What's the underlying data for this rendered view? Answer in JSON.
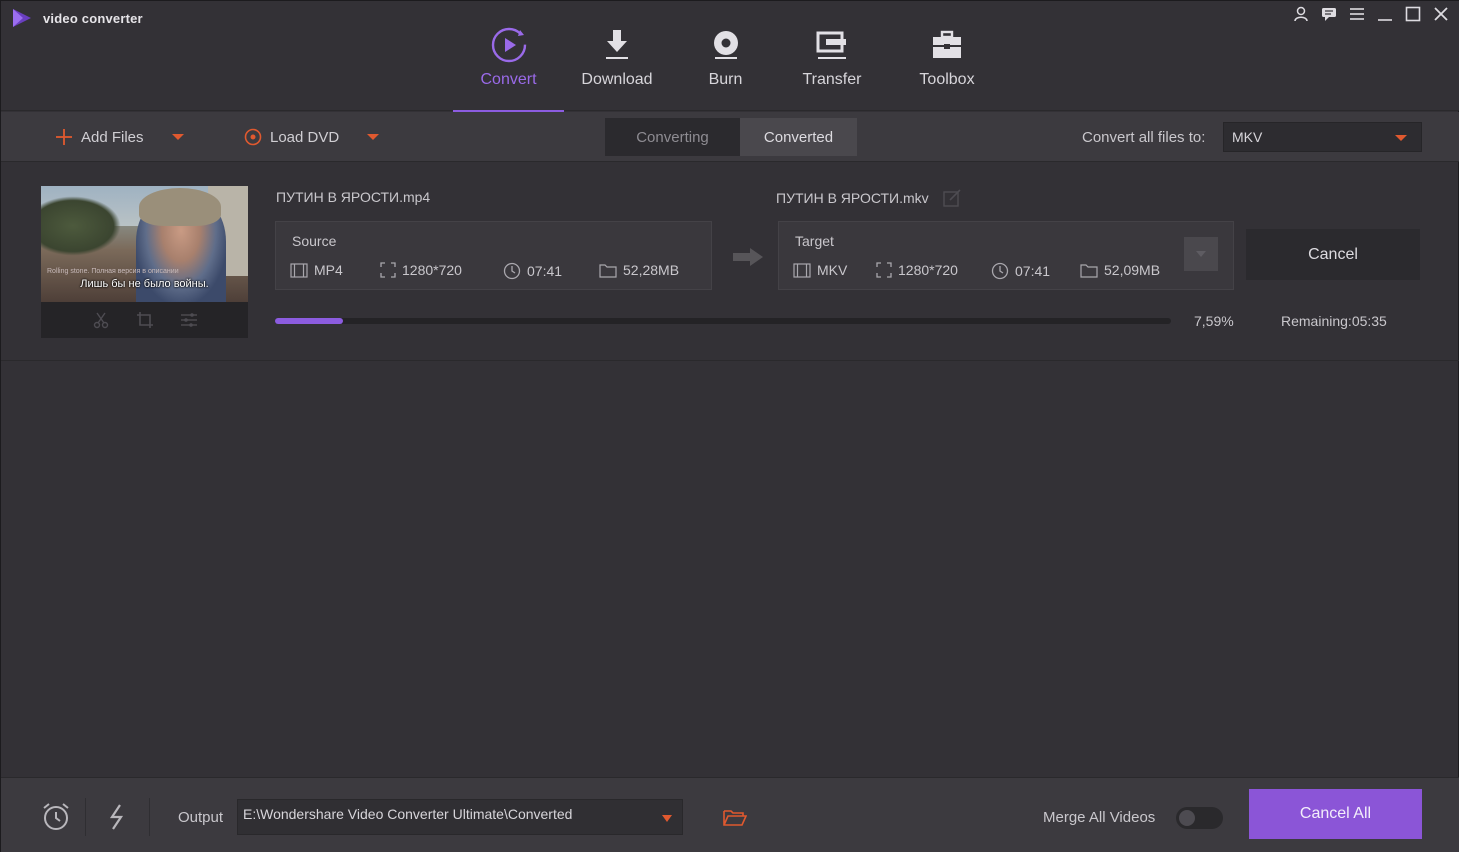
{
  "app": {
    "title": "video converter",
    "accent": "#8c5ce0",
    "orange": "#e0592f"
  },
  "window_controls": [
    "user-icon",
    "feedback-icon",
    "menu-icon",
    "minimize-icon",
    "maximize-icon",
    "close-icon"
  ],
  "nav": {
    "items": [
      {
        "label": "Convert",
        "icon": "convert-icon",
        "active": true
      },
      {
        "label": "Download",
        "icon": "download-icon",
        "active": false
      },
      {
        "label": "Burn",
        "icon": "burn-icon",
        "active": false
      },
      {
        "label": "Transfer",
        "icon": "transfer-icon",
        "active": false
      },
      {
        "label": "Toolbox",
        "icon": "toolbox-icon",
        "active": false
      }
    ]
  },
  "toolbar": {
    "add_files": "Add Files",
    "load_dvd": "Load DVD",
    "tabs": [
      "Converting",
      "Converted"
    ],
    "convert_all_label": "Convert all files to:",
    "format": "MKV"
  },
  "file": {
    "thumb_sub_small": "Rolling stone. Полная версия в описании",
    "thumb_sub_main": "Лишь бы не было войны.",
    "source_name": "ПУТИН В ЯРОСТИ.mp4",
    "target_name": "ПУТИН В ЯРОСТИ.mkv",
    "source": {
      "title": "Source",
      "format": "MP4",
      "resolution": "1280*720",
      "duration": "07:41",
      "size": "52,28MB"
    },
    "target": {
      "title": "Target",
      "format": "MKV",
      "resolution": "1280*720",
      "duration": "07:41",
      "size": "52,09MB"
    },
    "cancel": "Cancel",
    "progress_percent": 7.59,
    "progress_text": "7,59%",
    "remaining": "Remaining:05:35"
  },
  "bottom": {
    "output_label": "Output",
    "output_path": "E:\\Wondershare Video Converter Ultimate\\Converted",
    "merge_label": "Merge All Videos",
    "merge_on": false,
    "cancel_all": "Cancel All"
  }
}
